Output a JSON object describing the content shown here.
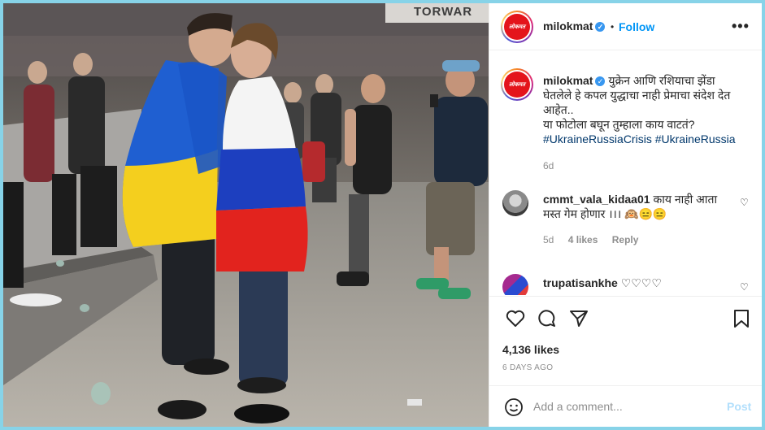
{
  "photo": {
    "alt_scene": "Couple wrapped in Ukrainian and Russian flags at a concert venue",
    "banner_text": "TORWAR",
    "colors": {
      "ukraine_blue": "#1f5fd1",
      "ukraine_yellow": "#f4cf1e",
      "russia_white": "#f4f4f4",
      "russia_blue": "#1d3fbf",
      "russia_red": "#e2231e"
    }
  },
  "post": {
    "author": "milokmat",
    "avatar_text": "लोकमत",
    "follow_label": "Follow",
    "more_label": "•••",
    "caption": "युक्रेन आणि रशियाचा झेंडा घेतलेले हे कपल युद्धाचा नाही प्रेमाचा संदेश देत आहेत.. या फोटोला बघून तुम्हाला काय वाटतं?",
    "caption_line1": "युक्रेन आणि रशियाचा झेंडा",
    "caption_line2": "घेतलेले हे कपल युद्धाचा नाही प्रेमाचा संदेश देत",
    "caption_line3": "आहेत..",
    "caption_line4": "या फोटोला बघून तुम्हाला काय वाटतं?",
    "hashtag1": "#UkraineRussiaCrisis",
    "hashtag2": "#UkraineRussia",
    "caption_time": "6d"
  },
  "comments": [
    {
      "user": "cmmt_vala_kidaa01",
      "text": "काय नाही आता",
      "text2": "मस्त गेम होणार ।।। 🙉😑😑",
      "time": "5d",
      "likes": "4 likes",
      "reply": "Reply"
    },
    {
      "user": "trupatisankhe",
      "text": "♡♡♡♡"
    }
  ],
  "actions": {
    "likes_count": "4,136 likes",
    "time_ago": "6 DAYS AGO"
  },
  "add_comment": {
    "placeholder": "Add a comment...",
    "post_label": "Post"
  }
}
